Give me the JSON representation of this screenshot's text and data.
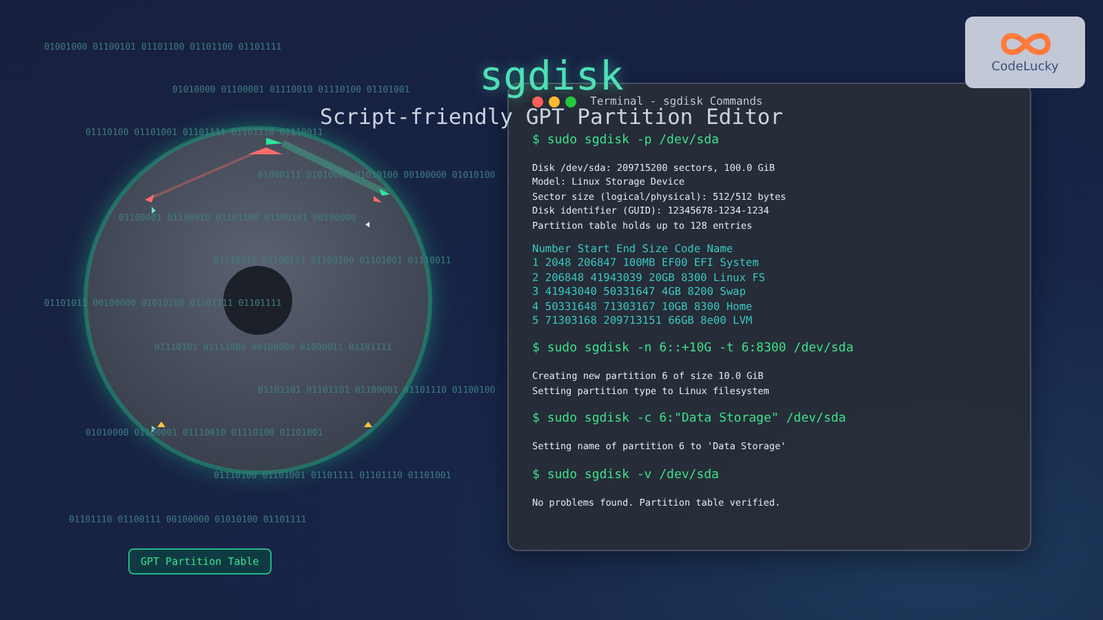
{
  "background_binary": [
    "01001000 01100101 01101100 01101100 01101111",
    "01010000 01100001 01110010 01110100 01101001",
    "01110100 01101001 01101111 01101110 01110011",
    "01000111 01010000 01010100 00100000 01010100",
    "01100001 01100010 01101100 01100101 00100000",
    "01110011 01100111 01100100 01101001 01110011",
    "01101011 00100000 01010100 01101111 01101111",
    "01110101 01111000 00100000 01000011 01101111",
    "01101101 01101101 01100001 01101110 01100100",
    "01010000 01100001 01110010 01110100 01101001",
    "01110100 01101001 01101111 01101110 01101001",
    "01101110 01100111 00100000 01010100 01101111"
  ],
  "title": "sgdisk",
  "subtitle": "Script-friendly GPT Partition Editor",
  "logo": {
    "text": "CodeLucky"
  },
  "terminal": {
    "title": "Terminal - sgdisk Commands",
    "blocks": [
      {
        "command": "$ sudo sgdisk -p /dev/sda",
        "output": [
          {
            "kind": "info",
            "text": "Disk /dev/sda: 209715200 sectors, 100.0 GiB"
          },
          {
            "kind": "info",
            "text": "Model: Linux Storage Device"
          },
          {
            "kind": "info",
            "text": "Sector size (logical/physical): 512/512 bytes"
          },
          {
            "kind": "info",
            "text": "Disk identifier (GUID): 12345678-1234-1234"
          },
          {
            "kind": "info",
            "text": "Partition table holds up to 128 entries"
          },
          {
            "kind": "table-head",
            "text": "Number Start End Size Code Name"
          },
          {
            "kind": "table-row",
            "text": "1 2048 206847 100MB EF00 EFI System"
          },
          {
            "kind": "table-row",
            "text": "2 206848 41943039 20GB 8300 Linux FS"
          },
          {
            "kind": "table-row",
            "text": "3 41943040 50331647 4GB 8200 Swap"
          },
          {
            "kind": "table-row",
            "text": "4 50331648 71303167 10GB 8300 Home"
          },
          {
            "kind": "table-row",
            "text": "5 71303168 209713151 66GB 8e00 LVM"
          }
        ]
      },
      {
        "command": "$ sudo sgdisk -n 6::+10G -t 6:8300 /dev/sda",
        "output": [
          {
            "kind": "info",
            "text": "Creating new partition 6 of size 10.0 GiB"
          },
          {
            "kind": "info",
            "text": "Setting partition type to Linux filesystem"
          }
        ]
      },
      {
        "command": "$ sudo sgdisk -c 6:\"Data Storage\" /dev/sda",
        "output": [
          {
            "kind": "info",
            "text": "Setting name of partition 6 to 'Data Storage'"
          }
        ]
      },
      {
        "command": "$ sudo sgdisk -v /dev/sda",
        "output": [
          {
            "kind": "info",
            "text": "No problems found. Partition table verified."
          }
        ]
      }
    ]
  },
  "badge": "GPT Partition Table"
}
